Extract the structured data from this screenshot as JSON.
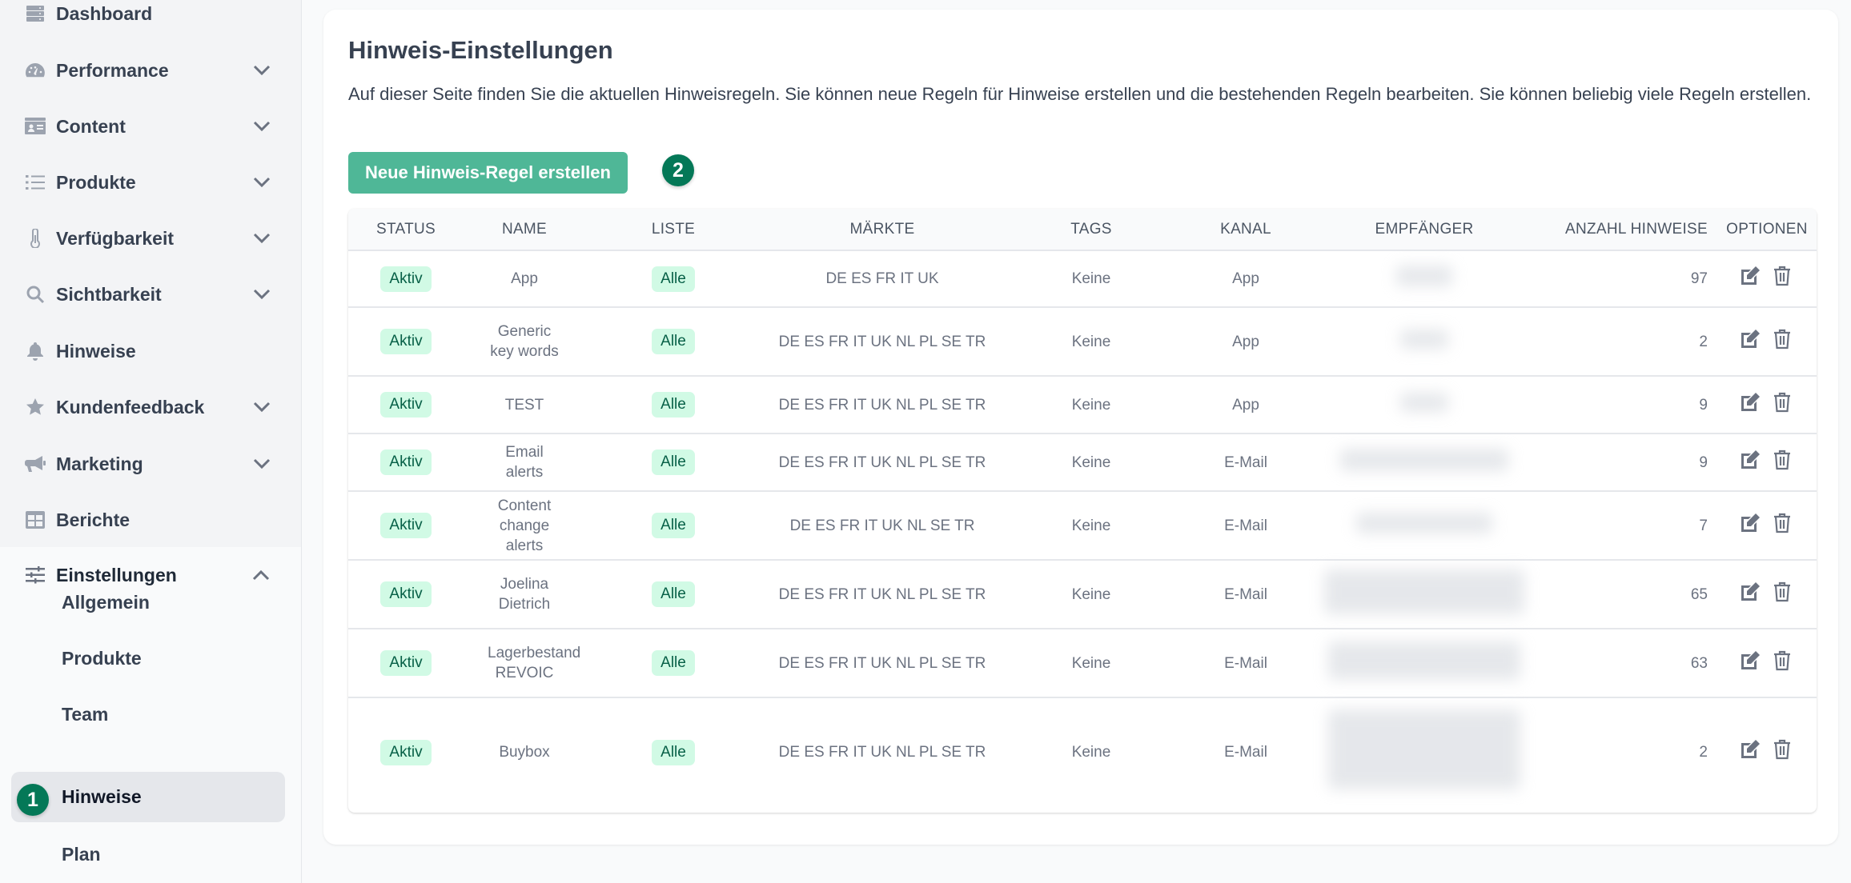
{
  "sidebar": {
    "items": [
      {
        "label": "Dashboard",
        "icon": "server-icon",
        "expandable": false
      },
      {
        "label": "Performance",
        "icon": "gauge-icon",
        "expandable": true
      },
      {
        "label": "Content",
        "icon": "id-card-icon",
        "expandable": true
      },
      {
        "label": "Produkte",
        "icon": "list-icon",
        "expandable": true
      },
      {
        "label": "Verfügbarkeit",
        "icon": "thermometer-icon",
        "expandable": true
      },
      {
        "label": "Sichtbarkeit",
        "icon": "search-icon",
        "expandable": true
      },
      {
        "label": "Hinweise",
        "icon": "bell-icon",
        "expandable": false
      },
      {
        "label": "Kundenfeedback",
        "icon": "star-icon",
        "expandable": true
      },
      {
        "label": "Marketing",
        "icon": "megaphone-icon",
        "expandable": true
      },
      {
        "label": "Berichte",
        "icon": "table-icon",
        "expandable": false
      },
      {
        "label": "Einstellungen",
        "icon": "sliders-icon",
        "expandable": true,
        "expanded": true
      }
    ],
    "settings_sub_items": [
      {
        "label": "Allgemein"
      },
      {
        "label": "Produkte"
      },
      {
        "label": "Team"
      },
      {
        "label": "Hinweise",
        "active": true
      },
      {
        "label": "Plan"
      }
    ],
    "step_badge": "1"
  },
  "main": {
    "title": "Hinweis-Einstellungen",
    "description": "Auf dieser Seite finden Sie die aktuellen Hinweisregeln. Sie können neue Regeln für Hinweise erstellen und die bestehenden Regeln bearbeiten. Sie können beliebig viele Regeln erstellen.",
    "new_rule_button": "Neue Hinweis-Regel erstellen",
    "step_badge": "2",
    "table": {
      "columns": [
        "Status",
        "Name",
        "Liste",
        "Märkte",
        "Tags",
        "Kanal",
        "Empfänger",
        "Anzahl Hinweise",
        "Optionen"
      ],
      "rows": [
        {
          "status": "Aktiv",
          "name": "App",
          "liste": "Alle",
          "maerkte": "DE ES FR IT UK",
          "tags": "Keine",
          "kanal": "App",
          "empfaenger": "[redacted]",
          "anzahl": "97"
        },
        {
          "status": "Aktiv",
          "name": "Generic key words",
          "liste": "Alle",
          "maerkte": "DE ES FR IT UK NL PL SE TR",
          "tags": "Keine",
          "kanal": "App",
          "empfaenger": "[redacted]",
          "anzahl": "2"
        },
        {
          "status": "Aktiv",
          "name": "TEST",
          "liste": "Alle",
          "maerkte": "DE ES FR IT UK NL PL SE TR",
          "tags": "Keine",
          "kanal": "App",
          "empfaenger": "[redacted]",
          "anzahl": "9"
        },
        {
          "status": "Aktiv",
          "name": "Email alerts",
          "liste": "Alle",
          "maerkte": "DE ES FR IT UK NL PL SE TR",
          "tags": "Keine",
          "kanal": "E-Mail",
          "empfaenger": "[redacted]",
          "anzahl": "9"
        },
        {
          "status": "Aktiv",
          "name": "Content change alerts",
          "liste": "Alle",
          "maerkte": "DE ES FR IT UK NL SE TR",
          "tags": "Keine",
          "kanal": "E-Mail",
          "empfaenger": "[redacted]",
          "anzahl": "7"
        },
        {
          "status": "Aktiv",
          "name": "Joelina Dietrich",
          "liste": "Alle",
          "maerkte": "DE ES FR IT UK NL PL SE TR",
          "tags": "Keine",
          "kanal": "E-Mail",
          "empfaenger": "[redacted]",
          "anzahl": "65"
        },
        {
          "status": "Aktiv",
          "name": "Lagerbestand REVOIC",
          "liste": "Alle",
          "maerkte": "DE ES FR IT UK NL PL SE TR",
          "tags": "Keine",
          "kanal": "E-Mail",
          "empfaenger": "[redacted]",
          "anzahl": "63"
        },
        {
          "status": "Aktiv",
          "name": "Buybox",
          "liste": "Alle",
          "maerkte": "DE ES FR IT UK NL PL SE TR",
          "tags": "Keine",
          "kanal": "E-Mail",
          "empfaenger": "[redacted]",
          "anzahl": "2"
        }
      ],
      "row_actions": [
        {
          "name": "edit",
          "icon": "edit-icon"
        },
        {
          "name": "delete",
          "icon": "trash-icon"
        }
      ]
    }
  },
  "colors": {
    "accent_button": "#4fb797",
    "badge_bg": "#d1fae5",
    "badge_text": "#065f46",
    "step_badge": "#047857"
  }
}
